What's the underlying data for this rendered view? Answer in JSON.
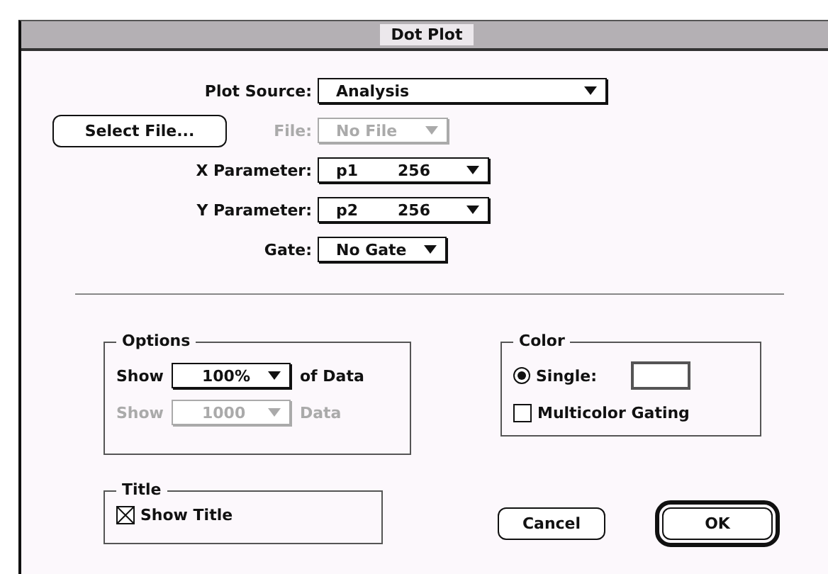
{
  "window": {
    "title": "Dot Plot"
  },
  "plot_source": {
    "label": "Plot Source:",
    "value": "Analysis"
  },
  "select_file_button": "Select File...",
  "file": {
    "label": "File:",
    "value": "No File",
    "disabled": true
  },
  "parameters": [
    {
      "label": "X Parameter:",
      "name": "p1",
      "size": "256"
    },
    {
      "label": "Y Parameter:",
      "name": "p2",
      "size": "256"
    }
  ],
  "gate": {
    "label": "Gate:",
    "value": "No Gate"
  },
  "options": {
    "title": "Options",
    "rows": [
      {
        "prefix": "Show",
        "value": "100%",
        "suffix": "of Data",
        "disabled": false
      },
      {
        "prefix": "Show",
        "value": "1000",
        "suffix": "Data",
        "disabled": true
      }
    ]
  },
  "color": {
    "title": "Color",
    "items": [
      {
        "kind": "radio",
        "label": "Single:",
        "selected": true
      },
      {
        "kind": "checkbox",
        "label": "Multicolor Gating",
        "checked": false
      }
    ]
  },
  "title_group": {
    "title": "Title",
    "checkbox": {
      "label": "Show Title",
      "checked": true
    }
  },
  "buttons": [
    {
      "label": "Cancel",
      "default": false
    },
    {
      "label": "OK",
      "default": true
    }
  ]
}
